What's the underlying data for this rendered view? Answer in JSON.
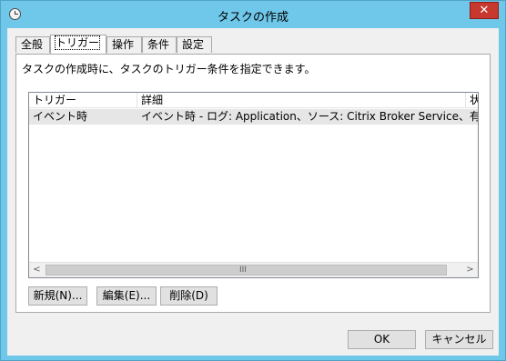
{
  "window": {
    "title": "タスクの作成",
    "close_glyph": "✕"
  },
  "tabs": [
    "全般",
    "トリガー",
    "操作",
    "条件",
    "設定"
  ],
  "active_tab": "トリガー",
  "panel": {
    "description": "タスクの作成時に、タスクのトリガー条件を指定できます。"
  },
  "list": {
    "columns": [
      "トリガー",
      "詳細",
      "状"
    ],
    "rows": [
      {
        "trigger": "イベント時",
        "details": "イベント時 - ログ: Application、ソース: Citrix Broker Service、イベント ...",
        "status": "有"
      }
    ]
  },
  "scroll": {
    "left": "<",
    "right": ">",
    "grip": "III"
  },
  "buttons": {
    "new": "新規(N)...",
    "edit": "編集(E)...",
    "delete": "削除(D)"
  },
  "footer": {
    "ok": "OK",
    "cancel": "キャンセル"
  },
  "colors": {
    "titlebar": "#6fc7ea",
    "close": "#c7382e",
    "selected_row": "#e6e6e6"
  },
  "icons": {
    "app": "clock-icon",
    "close": "close-icon"
  }
}
